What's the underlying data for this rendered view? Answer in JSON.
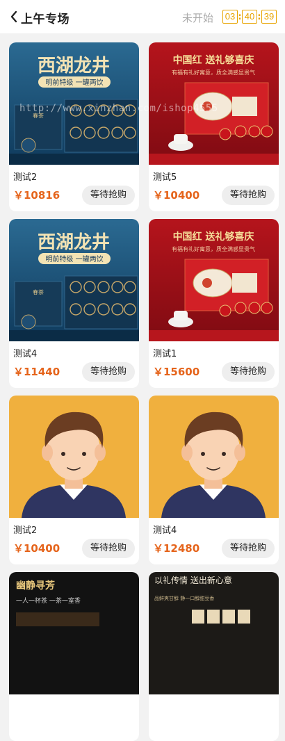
{
  "header": {
    "title": "上午专场",
    "status": "未开始",
    "countdown": {
      "hours": "03",
      "minutes": "40",
      "seconds": "39",
      "separator": ":"
    }
  },
  "products": [
    {
      "name": "测试2",
      "price": "￥10816",
      "button": "等待抢购",
      "image": "west-lake-longjing-tea",
      "image_title": "西湖龙井",
      "image_subtitle": "明前特级 一罐两饮"
    },
    {
      "name": "测试5",
      "price": "￥10400",
      "button": "等待抢购",
      "image": "china-red-gift-box",
      "image_title": "中国红 送礼够喜庆",
      "image_subtitle": "有福有礼好寓意，质全满感显贵气"
    },
    {
      "name": "测试4",
      "price": "￥11440",
      "button": "等待抢购",
      "image": "west-lake-longjing-tea",
      "image_title": "西湖龙井",
      "image_subtitle": "明前特级 一罐两饮"
    },
    {
      "name": "测试1",
      "price": "￥15600",
      "button": "等待抢购",
      "image": "china-red-gift-box",
      "image_title": "中国红 送礼够喜庆",
      "image_subtitle": "有福有礼好寓意，质全满感显贵气"
    },
    {
      "name": "测试2",
      "price": "￥10400",
      "button": "等待抢购",
      "image": "avatar-placeholder"
    },
    {
      "name": "测试4",
      "price": "￥12480",
      "button": "等待抢购",
      "image": "avatar-placeholder"
    },
    {
      "name": "",
      "price": "",
      "button": "",
      "image": "dark-tea-box",
      "image_title": "幽静寻芳",
      "image_subtitle": "一人一杯茶 一茶一室香"
    },
    {
      "name": "",
      "price": "",
      "button": "",
      "image": "gift-tea-set",
      "image_title": "以礼传情 送出新心意",
      "image_subtitle": "品鲜爽甘醇 静一口醇甜豆香"
    }
  ],
  "watermark": "http://www.xinzhan.com/ishop4555",
  "colors": {
    "accent": "#e5641b",
    "countdown": "#e8a400",
    "background": "#f2f2f2"
  }
}
